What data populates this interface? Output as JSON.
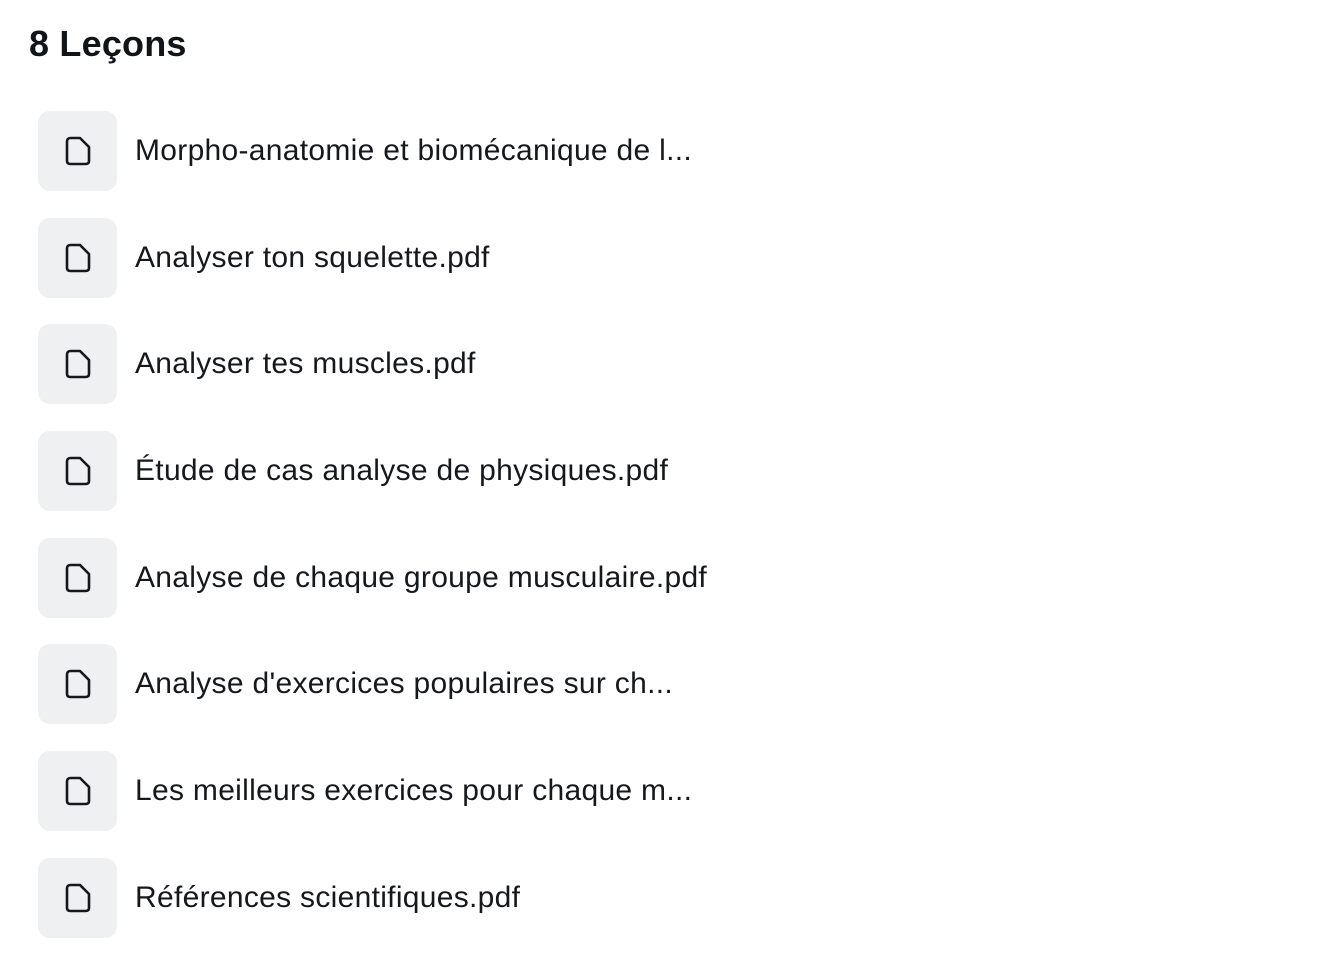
{
  "section": {
    "title": "8 Leçons"
  },
  "lessons": [
    {
      "label": "Morpho-anatomie et biomécanique de l...",
      "icon": "file-icon"
    },
    {
      "label": "Analyser ton squelette.pdf",
      "icon": "file-icon"
    },
    {
      "label": "Analyser tes muscles.pdf",
      "icon": "file-icon"
    },
    {
      "label": "Étude de cas analyse de physiques.pdf",
      "icon": "file-icon"
    },
    {
      "label": "Analyse de chaque groupe musculaire.pdf",
      "icon": "file-icon"
    },
    {
      "label": "Analyse d'exercices populaires sur ch...",
      "icon": "file-icon"
    },
    {
      "label": "Les meilleurs exercices pour chaque m...",
      "icon": "file-icon"
    },
    {
      "label": "Références scientifiques.pdf",
      "icon": "file-icon"
    }
  ]
}
